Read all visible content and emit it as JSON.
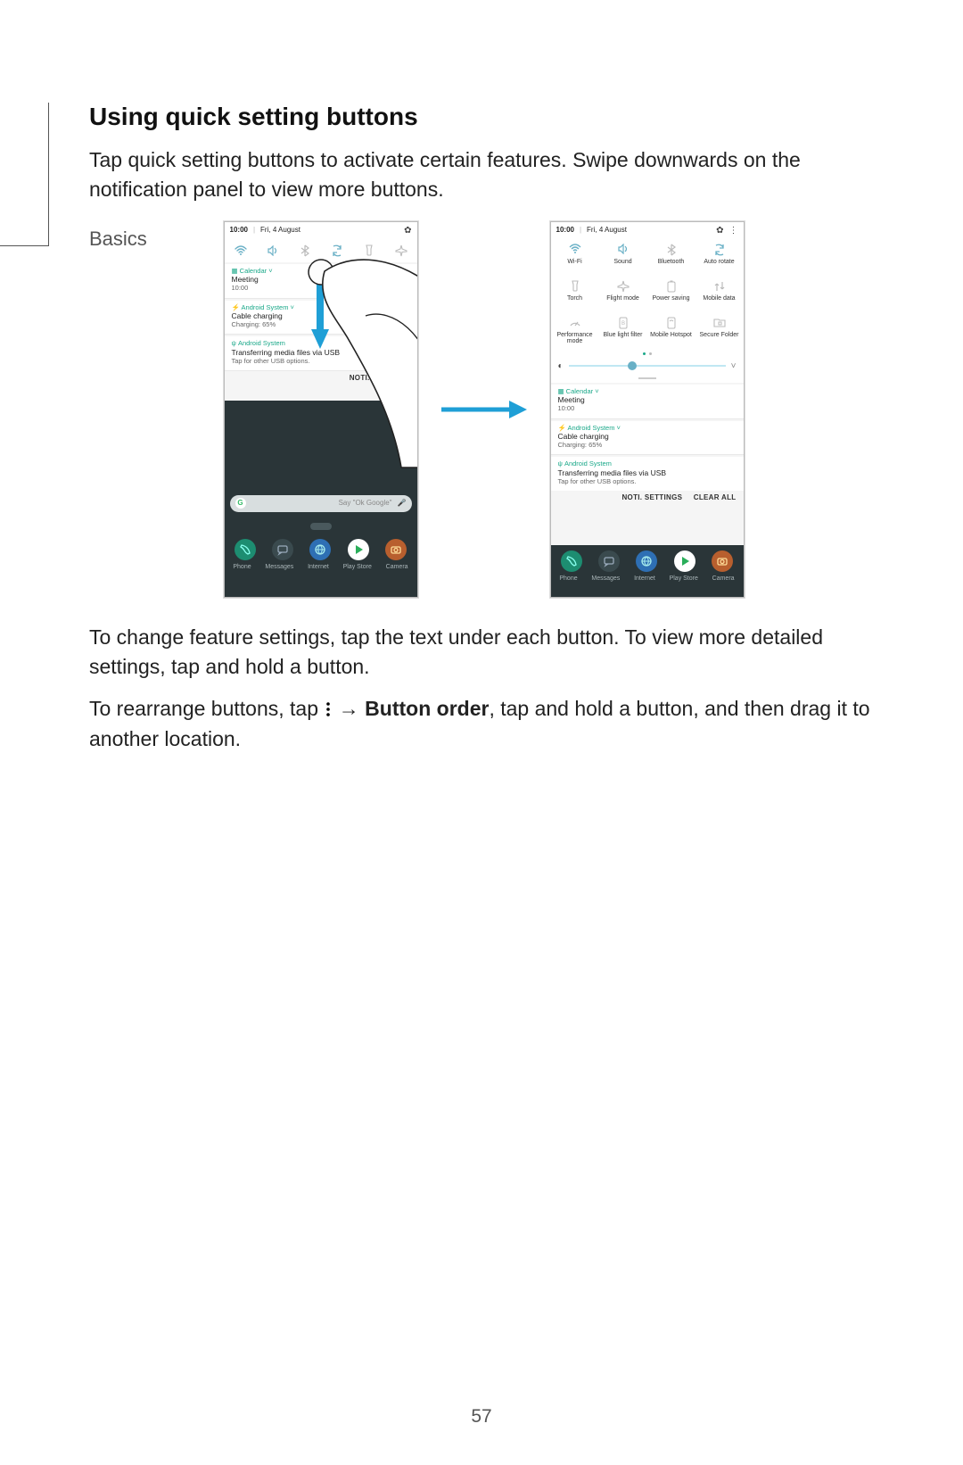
{
  "header": {
    "section": "Basics"
  },
  "heading": "Using quick setting buttons",
  "para1": "Tap quick setting buttons to activate certain features. Swipe downwards on the notification panel to view more buttons.",
  "para2": "To change feature settings, tap the text under each button. To view more detailed settings, tap and hold a button.",
  "para3_a": "To rearrange buttons, tap ",
  "para3_b": " → ",
  "para3_button_order": "Button order",
  "para3_c": ", tap and hold a button, and then drag it to another location.",
  "page_number": "57",
  "status": {
    "time": "10:00",
    "date": "Fri, 4 August"
  },
  "notifications": {
    "calendar": {
      "app": "Calendar",
      "title": "Meeting",
      "sub": "10:00"
    },
    "charging": {
      "app": "Android System",
      "title": "Cable charging",
      "sub": "Charging: 65%"
    },
    "usb": {
      "app": "Android System",
      "title": "Transferring media files via USB",
      "sub": "Tap for other USB options."
    }
  },
  "actions": {
    "noti_settings": "NOTI. SETTINGS",
    "clear_all": "CLEAR ALL"
  },
  "search": {
    "g": "G",
    "hint": "Say \"Ok Google\""
  },
  "dock": {
    "phone": "Phone",
    "messages": "Messages",
    "internet": "Internet",
    "play": "Play Store",
    "camera": "Camera"
  },
  "tiles": {
    "wifi": "Wi-Fi",
    "sound": "Sound",
    "bluetooth": "Bluetooth",
    "autorotate": "Auto\nrotate",
    "torch": "Torch",
    "flight": "Flight\nmode",
    "powersaving": "Power\nsaving",
    "mobiledata": "Mobile\ndata",
    "perf": "Performance\nmode",
    "bluelight": "Blue light\nfilter",
    "hotspot": "Mobile\nHotspot",
    "secure": "Secure\nFolder"
  }
}
